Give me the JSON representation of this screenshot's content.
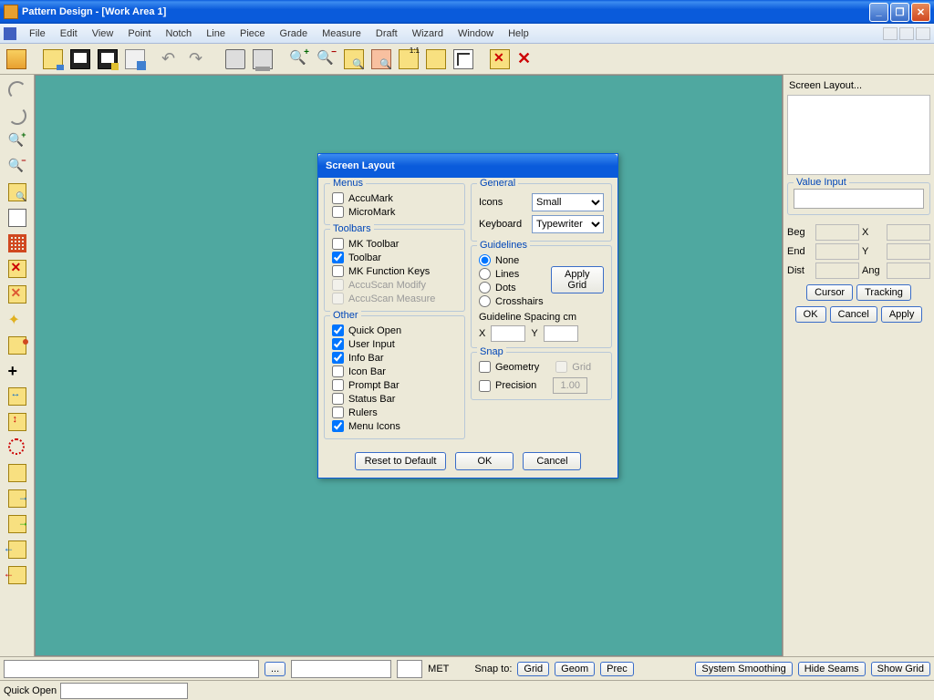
{
  "titlebar": {
    "title": "Pattern Design - [Work Area 1]"
  },
  "menubar": [
    "File",
    "Edit",
    "View",
    "Point",
    "Notch",
    "Line",
    "Piece",
    "Grade",
    "Measure",
    "Draft",
    "Wizard",
    "Window",
    "Help"
  ],
  "right": {
    "panel_title": "Screen Layout...",
    "value_input_legend": "Value Input",
    "labels": {
      "beg": "Beg",
      "end": "End",
      "dist": "Dist",
      "x": "X",
      "y": "Y",
      "ang": "Ang"
    },
    "buttons": {
      "cursor": "Cursor",
      "tracking": "Tracking",
      "ok": "OK",
      "cancel": "Cancel",
      "apply": "Apply"
    }
  },
  "infobar": {
    "met": "MET",
    "snap_to": "Snap to:",
    "grid": "Grid",
    "geom": "Geom",
    "prec": "Prec",
    "system_smoothing": "System Smoothing",
    "hide_seams": "Hide Seams",
    "show_grid": "Show Grid"
  },
  "statusbar": {
    "quick_open": "Quick Open"
  },
  "dialog": {
    "title": "Screen Layout",
    "menus": {
      "legend": "Menus",
      "accumark": "AccuMark",
      "micromark": "MicroMark"
    },
    "toolbars": {
      "legend": "Toolbars",
      "mk_toolbar": "MK Toolbar",
      "toolbar": "Toolbar",
      "mk_fn": "MK Function Keys",
      "accuscan_modify": "AccuScan Modify",
      "accuscan_measure": "AccuScan Measure"
    },
    "other": {
      "legend": "Other",
      "quick_open": "Quick Open",
      "user_input": "User Input",
      "info_bar": "Info Bar",
      "icon_bar": "Icon Bar",
      "prompt_bar": "Prompt Bar",
      "status_bar": "Status Bar",
      "rulers": "Rulers",
      "menu_icons": "Menu Icons"
    },
    "general": {
      "legend": "General",
      "icons": "Icons",
      "icons_val": "Small",
      "keyboard": "Keyboard",
      "keyboard_val": "Typewriter"
    },
    "guidelines": {
      "legend": "Guidelines",
      "none": "None",
      "lines": "Lines",
      "dots": "Dots",
      "crosshairs": "Crosshairs",
      "apply_grid": "Apply Grid",
      "spacing": "Guideline Spacing cm",
      "x": "X",
      "y": "Y"
    },
    "snap": {
      "legend": "Snap",
      "geometry": "Geometry",
      "grid": "Grid",
      "precision": "Precision",
      "prec_val": "1.00"
    },
    "buttons": {
      "reset": "Reset to Default",
      "ok": "OK",
      "cancel": "Cancel"
    }
  }
}
